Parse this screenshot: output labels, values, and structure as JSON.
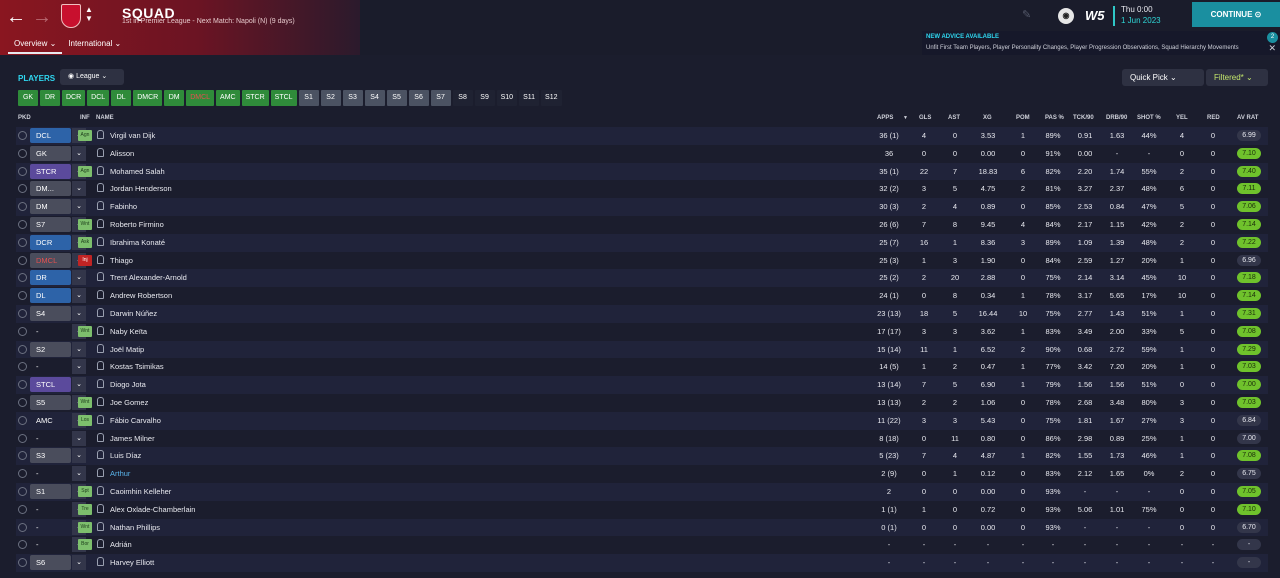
{
  "header": {
    "title": "SQUAD",
    "subtitle": "1st in Premier League - Next Match: Napoli (N) (9 days)",
    "tabs": [
      {
        "label": "Overview ⌄"
      },
      {
        "label": "International ⌄"
      }
    ],
    "sponsor": "W5",
    "date_line1": "Thu 0:00",
    "date_line2": "1 Jun 2023",
    "continue_label": "CONTINUE ⊙"
  },
  "advice": {
    "title": "NEW ADVICE AVAILABLE",
    "text": "Unfit First Team Players, Player Personality Changes, Player Progression Observations, Squad Hierarchy Movements",
    "count": "2"
  },
  "toolbar": {
    "players_label": "PLAYERS",
    "league_label": "League ⌄",
    "quick_pick_label": "Quick Pick  ⌄",
    "filtered_label": "Filtered*  ⌄"
  },
  "positions": [
    {
      "label": "GK",
      "style": "green"
    },
    {
      "label": "DR",
      "style": "green"
    },
    {
      "label": "DCR",
      "style": "green"
    },
    {
      "label": "DCL",
      "style": "green"
    },
    {
      "label": "DL",
      "style": "green"
    },
    {
      "label": "DMCR",
      "style": "green"
    },
    {
      "label": "DM",
      "style": "green"
    },
    {
      "label": "DMCL",
      "style": "red"
    },
    {
      "label": "AMC",
      "style": "green"
    },
    {
      "label": "STCR",
      "style": "green"
    },
    {
      "label": "STCL",
      "style": "green"
    },
    {
      "label": "S1",
      "style": "gray"
    },
    {
      "label": "S2",
      "style": "gray"
    },
    {
      "label": "S3",
      "style": "gray"
    },
    {
      "label": "S4",
      "style": "gray"
    },
    {
      "label": "S5",
      "style": "gray"
    },
    {
      "label": "S6",
      "style": "gray"
    },
    {
      "label": "S7",
      "style": "gray"
    },
    {
      "label": "S8",
      "style": "dark"
    },
    {
      "label": "S9",
      "style": "dark"
    },
    {
      "label": "S10",
      "style": "dark"
    },
    {
      "label": "S11",
      "style": "dark"
    },
    {
      "label": "S12",
      "style": "dark"
    }
  ],
  "columns": {
    "pkd": "PKD",
    "inf": "INF",
    "name": "NAME",
    "apps": "APPS",
    "gls": "GLS",
    "ast": "AST",
    "xg": "XG",
    "pom": "POM",
    "pas": "PAS %",
    "tck": "TCK/90",
    "drb": "DRB/90",
    "shot": "SHOT %",
    "yel": "YEL",
    "red": "RED",
    "avrat": "AV RAT"
  },
  "players": [
    {
      "pos": "DCL",
      "pos_style": "blue",
      "inf": "Agn",
      "inf_style": "green",
      "name": "Virgil van Dijk",
      "apps": "36 (1)",
      "gls": "4",
      "ast": "0",
      "xg": "3.53",
      "pom": "1",
      "pas": "89%",
      "tck": "0.91",
      "drb": "1.63",
      "shot": "44%",
      "yel": "4",
      "red": "0",
      "rat": "6.99",
      "rat_style": "dark"
    },
    {
      "pos": "GK",
      "pos_style": "gray",
      "inf": "",
      "inf_style": "",
      "name": "Alisson",
      "apps": "36",
      "gls": "0",
      "ast": "0",
      "xg": "0.00",
      "pom": "0",
      "pas": "91%",
      "tck": "0.00",
      "drb": "-",
      "shot": "-",
      "yel": "0",
      "red": "0",
      "rat": "7.10",
      "rat_style": "green"
    },
    {
      "pos": "STCR",
      "pos_style": "purple",
      "inf": "Agn",
      "inf_style": "green",
      "name": "Mohamed Salah",
      "apps": "35 (1)",
      "gls": "22",
      "ast": "7",
      "xg": "18.83",
      "pom": "6",
      "pas": "82%",
      "tck": "2.20",
      "drb": "1.74",
      "shot": "55%",
      "yel": "2",
      "red": "0",
      "rat": "7.40",
      "rat_style": "green"
    },
    {
      "pos": "DM...",
      "pos_style": "gray",
      "inf": "",
      "inf_style": "",
      "name": "Jordan Henderson",
      "apps": "32 (2)",
      "gls": "3",
      "ast": "5",
      "xg": "4.75",
      "pom": "2",
      "pas": "81%",
      "tck": "3.27",
      "drb": "2.37",
      "shot": "48%",
      "yel": "6",
      "red": "0",
      "rat": "7.11",
      "rat_style": "green"
    },
    {
      "pos": "DM",
      "pos_style": "gray",
      "inf": "",
      "inf_style": "",
      "name": "Fabinho",
      "apps": "30 (3)",
      "gls": "2",
      "ast": "4",
      "xg": "0.89",
      "pom": "0",
      "pas": "85%",
      "tck": "2.53",
      "drb": "0.84",
      "shot": "47%",
      "yel": "5",
      "red": "0",
      "rat": "7.06",
      "rat_style": "green"
    },
    {
      "pos": "S7",
      "pos_style": "gray",
      "inf": "Wnt",
      "inf_style": "green",
      "name": "Roberto Firmino",
      "apps": "26 (6)",
      "gls": "7",
      "ast": "8",
      "xg": "9.45",
      "pom": "4",
      "pas": "84%",
      "tck": "2.17",
      "drb": "1.15",
      "shot": "42%",
      "yel": "2",
      "red": "0",
      "rat": "7.14",
      "rat_style": "green"
    },
    {
      "pos": "DCR",
      "pos_style": "blue",
      "inf": "Ask",
      "inf_style": "green",
      "name": "Ibrahima Konaté",
      "apps": "25 (7)",
      "gls": "16",
      "ast": "1",
      "xg": "8.36",
      "pom": "3",
      "pas": "89%",
      "tck": "1.09",
      "drb": "1.39",
      "shot": "48%",
      "yel": "2",
      "red": "0",
      "rat": "7.22",
      "rat_style": "green"
    },
    {
      "pos": "DMCL",
      "pos_style": "red",
      "inf": "Inj",
      "inf_style": "red",
      "name": "Thiago",
      "apps": "25 (3)",
      "gls": "1",
      "ast": "3",
      "xg": "1.90",
      "pom": "0",
      "pas": "84%",
      "tck": "2.59",
      "drb": "1.27",
      "shot": "20%",
      "yel": "1",
      "red": "0",
      "rat": "6.96",
      "rat_style": "dark"
    },
    {
      "pos": "DR",
      "pos_style": "blue",
      "inf": "",
      "inf_style": "",
      "name": "Trent Alexander-Arnold",
      "apps": "25 (2)",
      "gls": "2",
      "ast": "20",
      "xg": "2.88",
      "pom": "0",
      "pas": "75%",
      "tck": "2.14",
      "drb": "3.14",
      "shot": "45%",
      "yel": "10",
      "red": "0",
      "rat": "7.18",
      "rat_style": "green"
    },
    {
      "pos": "DL",
      "pos_style": "blue",
      "inf": "",
      "inf_style": "",
      "name": "Andrew Robertson",
      "apps": "24 (1)",
      "gls": "0",
      "ast": "8",
      "xg": "0.34",
      "pom": "1",
      "pas": "78%",
      "tck": "3.17",
      "drb": "5.65",
      "shot": "17%",
      "yel": "10",
      "red": "0",
      "rat": "7.14",
      "rat_style": "green"
    },
    {
      "pos": "S4",
      "pos_style": "gray",
      "inf": "",
      "inf_style": "",
      "name": "Darwin Núñez",
      "apps": "23 (13)",
      "gls": "18",
      "ast": "5",
      "xg": "16.44",
      "pom": "10",
      "pas": "75%",
      "tck": "2.77",
      "drb": "1.43",
      "shot": "51%",
      "yel": "1",
      "red": "0",
      "rat": "7.31",
      "rat_style": "green"
    },
    {
      "pos": "-",
      "pos_style": "none",
      "inf": "Wnt",
      "inf_style": "green",
      "name": "Naby Keïta",
      "apps": "17 (17)",
      "gls": "3",
      "ast": "3",
      "xg": "3.62",
      "pom": "1",
      "pas": "83%",
      "tck": "3.49",
      "drb": "2.00",
      "shot": "33%",
      "yel": "5",
      "red": "0",
      "rat": "7.08",
      "rat_style": "green"
    },
    {
      "pos": "S2",
      "pos_style": "gray",
      "inf": "",
      "inf_style": "",
      "name": "Joël Matip",
      "apps": "15 (14)",
      "gls": "11",
      "ast": "1",
      "xg": "6.52",
      "pom": "2",
      "pas": "90%",
      "tck": "0.68",
      "drb": "2.72",
      "shot": "59%",
      "yel": "1",
      "red": "0",
      "rat": "7.29",
      "rat_style": "green"
    },
    {
      "pos": "-",
      "pos_style": "none",
      "inf": "",
      "inf_style": "",
      "name": "Kostas Tsimikas",
      "apps": "14 (5)",
      "gls": "1",
      "ast": "2",
      "xg": "0.47",
      "pom": "1",
      "pas": "77%",
      "tck": "3.42",
      "drb": "7.20",
      "shot": "20%",
      "yel": "1",
      "red": "0",
      "rat": "7.03",
      "rat_style": "green"
    },
    {
      "pos": "STCL",
      "pos_style": "purple",
      "inf": "",
      "inf_style": "",
      "name": "Diogo Jota",
      "apps": "13 (14)",
      "gls": "7",
      "ast": "5",
      "xg": "6.90",
      "pom": "1",
      "pas": "79%",
      "tck": "1.56",
      "drb": "1.56",
      "shot": "51%",
      "yel": "0",
      "red": "0",
      "rat": "7.00",
      "rat_style": "green"
    },
    {
      "pos": "S5",
      "pos_style": "gray",
      "inf": "Wnt",
      "inf_style": "green",
      "name": "Joe Gomez",
      "apps": "13 (13)",
      "gls": "2",
      "ast": "2",
      "xg": "1.06",
      "pom": "0",
      "pas": "78%",
      "tck": "2.68",
      "drb": "3.48",
      "shot": "80%",
      "yel": "3",
      "red": "0",
      "rat": "7.03",
      "rat_style": "green"
    },
    {
      "pos": "AMC",
      "pos_style": "none",
      "inf": "Los",
      "inf_style": "green",
      "name": "Fábio Carvalho",
      "apps": "11 (22)",
      "gls": "3",
      "ast": "3",
      "xg": "5.43",
      "pom": "0",
      "pas": "75%",
      "tck": "1.81",
      "drb": "1.67",
      "shot": "27%",
      "yel": "3",
      "red": "0",
      "rat": "6.84",
      "rat_style": "dark"
    },
    {
      "pos": "-",
      "pos_style": "none",
      "inf": "",
      "inf_style": "",
      "name": "James Milner",
      "apps": "8 (18)",
      "gls": "0",
      "ast": "11",
      "xg": "0.80",
      "pom": "0",
      "pas": "86%",
      "tck": "2.98",
      "drb": "0.89",
      "shot": "25%",
      "yel": "1",
      "red": "0",
      "rat": "7.00",
      "rat_style": "dark"
    },
    {
      "pos": "S3",
      "pos_style": "gray",
      "inf": "",
      "inf_style": "",
      "name": "Luis Díaz",
      "apps": "5 (23)",
      "gls": "7",
      "ast": "4",
      "xg": "4.87",
      "pom": "1",
      "pas": "82%",
      "tck": "1.55",
      "drb": "1.73",
      "shot": "46%",
      "yel": "1",
      "red": "0",
      "rat": "7.08",
      "rat_style": "green"
    },
    {
      "pos": "-",
      "pos_style": "none",
      "inf": "",
      "inf_style": "",
      "name": "Arthur",
      "name_style": "blue",
      "apps": "2 (9)",
      "gls": "0",
      "ast": "1",
      "xg": "0.12",
      "pom": "0",
      "pas": "83%",
      "tck": "2.12",
      "drb": "1.65",
      "shot": "0%",
      "yel": "2",
      "red": "0",
      "rat": "6.75",
      "rat_style": "dark"
    },
    {
      "pos": "S1",
      "pos_style": "gray",
      "inf": "Spt",
      "inf_style": "green",
      "name": "Caoimhin Kelleher",
      "apps": "2",
      "gls": "0",
      "ast": "0",
      "xg": "0.00",
      "pom": "0",
      "pas": "93%",
      "tck": "-",
      "drb": "-",
      "shot": "-",
      "yel": "0",
      "red": "0",
      "rat": "7.05",
      "rat_style": "green"
    },
    {
      "pos": "-",
      "pos_style": "none",
      "inf": "Tre",
      "inf_style": "green",
      "name": "Alex Oxlade-Chamberlain",
      "apps": "1 (1)",
      "gls": "1",
      "ast": "0",
      "xg": "0.72",
      "pom": "0",
      "pas": "93%",
      "tck": "5.06",
      "drb": "1.01",
      "shot": "75%",
      "yel": "0",
      "red": "0",
      "rat": "7.10",
      "rat_style": "green"
    },
    {
      "pos": "-",
      "pos_style": "none",
      "inf": "Wnt",
      "inf_style": "green",
      "name": "Nathan Phillips",
      "apps": "0 (1)",
      "gls": "0",
      "ast": "0",
      "xg": "0.00",
      "pom": "0",
      "pas": "93%",
      "tck": "-",
      "drb": "-",
      "shot": "-",
      "yel": "0",
      "red": "0",
      "rat": "6.70",
      "rat_style": "dark"
    },
    {
      "pos": "-",
      "pos_style": "none",
      "inf": "Bor",
      "inf_style": "green",
      "name": "Adrián",
      "apps": "-",
      "gls": "-",
      "ast": "-",
      "xg": "-",
      "pom": "-",
      "pas": "-",
      "tck": "-",
      "drb": "-",
      "shot": "-",
      "yel": "-",
      "red": "-",
      "rat": "-",
      "rat_style": "dark"
    },
    {
      "pos": "S6",
      "pos_style": "gray",
      "inf": "",
      "inf_style": "",
      "name": "Harvey Elliott",
      "apps": "-",
      "gls": "-",
      "ast": "-",
      "xg": "-",
      "pom": "-",
      "pas": "-",
      "tck": "-",
      "drb": "-",
      "shot": "-",
      "yel": "-",
      "red": "-",
      "rat": "-",
      "rat_style": "dark"
    }
  ]
}
